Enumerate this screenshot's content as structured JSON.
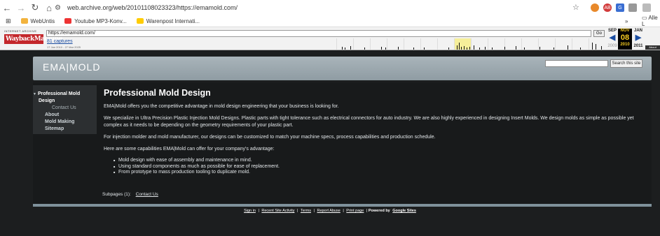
{
  "browser": {
    "url": "web.archive.org/web/20101108023323/https://emamold.com/",
    "bookmarks": [
      "WebUntis",
      "Youtube MP3-Konv...",
      "Warenpost Internati..."
    ],
    "all_bookmarks": "Alle L"
  },
  "wayback": {
    "logo_top": "INTERNET ARCHIVE",
    "logo_main": "WaybackMachine",
    "url_value": "https://emamold.com/",
    "go_label": "Go",
    "captures": "81 captures",
    "range": "17 Jan 2010 - 27 Mar 2025",
    "cal_prev": {
      "month": "SEP",
      "year": "2009"
    },
    "cal_active": {
      "month": "NOV",
      "day": "08",
      "year": "2010"
    },
    "cal_next": {
      "month": "JAN",
      "year": "2011"
    },
    "about": "About"
  },
  "site": {
    "title": "EMA|MOLD",
    "search_button": "Search this site",
    "nav": {
      "active": "Professional Mold Design",
      "contact": "Contact Us",
      "about": "About",
      "mold_making": "Mold Making",
      "sitemap": "Sitemap"
    },
    "heading": "Professional Mold Design",
    "p1": "EMA|Mold offers you the competitive advantage in mold design engineering that your business is looking for.",
    "p2": "We specialize in Ultra Precision Plastic Injection Mold Designs. Plastic parts with tight tolerance such as electrical connectors for auto industry. We are also highly experienced in designing Insert Molds. We design molds as simple as possible yet complex as it needs to be depending on the geometry requirements of your plastic part.",
    "p3": "For injection molder and mold manufacturer, our designs can be customized to match your machine specs, process capabilities and production schedule.",
    "p4": "Here are some capabilities EMA|Mold can offer for your company's advantage:",
    "list": [
      "Mold design with ease of assembly and maintenance in mind.",
      "Using standard components as much as possible for ease of replacement.",
      "From prototype to mass production tooling to duplicate mold."
    ],
    "subpages_label": "Subpages (1):",
    "subpages_link": "Contact Us",
    "footer": {
      "sign_in": "Sign in",
      "recent": "Recent Site Activity",
      "terms": "Terms",
      "report": "Report Abuse",
      "print": "Print page",
      "powered": "Powered by",
      "google": "Google Sites"
    }
  }
}
